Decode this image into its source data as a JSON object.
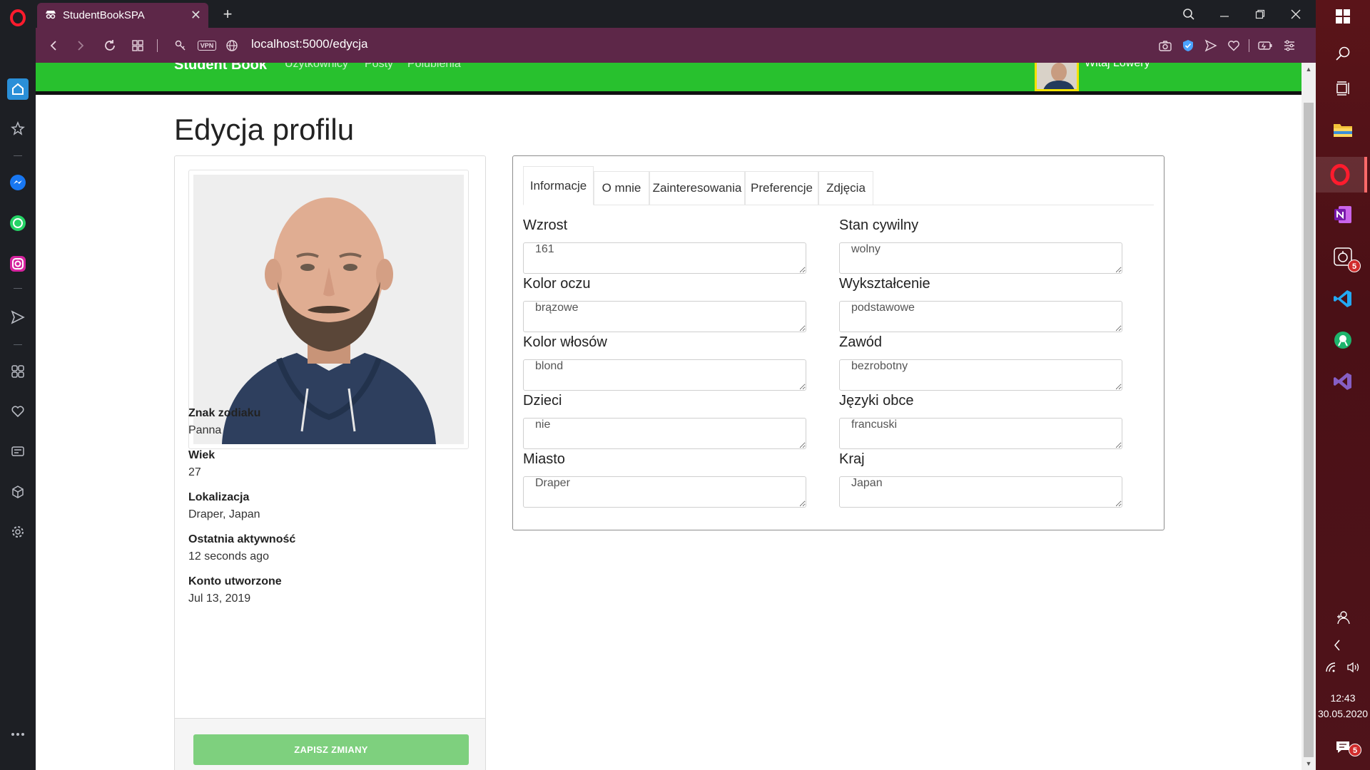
{
  "browser": {
    "tab_title": "StudentBookSPA",
    "url": "localhost:5000/edycja",
    "vpn_label": "VPN",
    "taskbar_badge_count": "5",
    "notification_badge_count": "5"
  },
  "site_nav": {
    "brand": "Student Book",
    "links": [
      "Użytkownicy",
      "Posty",
      "Polubienia"
    ],
    "greeting": "Witaj Lowery"
  },
  "page": {
    "title": "Edycja profilu"
  },
  "profile": {
    "items": [
      {
        "label": "Znak zodiaku",
        "value": "Panna"
      },
      {
        "label": "Wiek",
        "value": "27"
      },
      {
        "label": "Lokalizacja",
        "value": "Draper, Japan"
      },
      {
        "label": "Ostatnia aktywność",
        "value": "12 seconds ago"
      },
      {
        "label": "Konto utworzone",
        "value": "Jul 13, 2019"
      }
    ],
    "save_label": "ZAPISZ ZMIANY"
  },
  "tabs": [
    "Informacje",
    "O mnie",
    "Zainteresowania",
    "Preferencje",
    "Zdjęcia"
  ],
  "active_tab": "Informacje",
  "fields": {
    "left": [
      {
        "label": "Wzrost",
        "value": "161"
      },
      {
        "label": "Kolor oczu",
        "value": "brązowe"
      },
      {
        "label": "Kolor włosów",
        "value": "blond"
      },
      {
        "label": "Dzieci",
        "value": "nie"
      },
      {
        "label": "Miasto",
        "value": "Draper"
      }
    ],
    "right": [
      {
        "label": "Stan cywilny",
        "value": "wolny"
      },
      {
        "label": "Wykształcenie",
        "value": "podstawowe"
      },
      {
        "label": "Zawód",
        "value": "bezrobotny"
      },
      {
        "label": "Języki obce",
        "value": "francuski"
      },
      {
        "label": "Kraj",
        "value": "Japan"
      }
    ]
  },
  "clock": {
    "time": "12:43",
    "date": "30.05.2020"
  },
  "colors": {
    "navbar": "#28c12e",
    "address_bar": "#5d2748",
    "save_button": "#7ed07e",
    "taskbar": "#4a1016"
  }
}
